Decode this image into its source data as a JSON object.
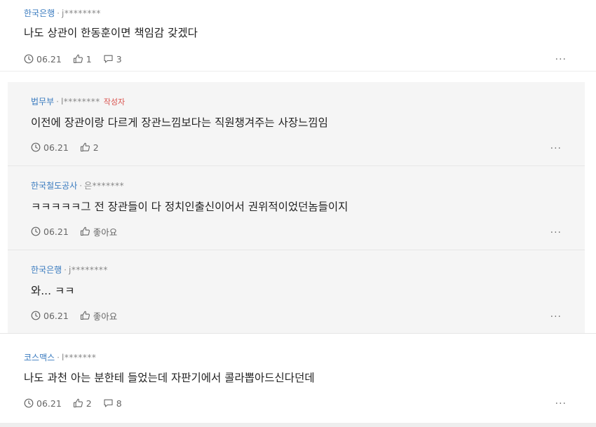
{
  "comments": [
    {
      "org": "한국은행",
      "user": "j********",
      "text": "나도 상관이 한동훈이면 책임감 갖겠다",
      "date": "06.21",
      "likes": "1",
      "replies": "3",
      "more": "···"
    }
  ],
  "replies": [
    {
      "org": "법무부",
      "user": "l********",
      "badge": "작성자",
      "text": "이전에 장관이랑 다르게 장관느낌보다는 직원챙겨주는 사장느낌임",
      "date": "06.21",
      "likes": "2",
      "more": "···"
    },
    {
      "org": "한국철도공사",
      "user": "은*******",
      "text": "ㅋㅋㅋㅋㅋ그 전 장관들이 다 정치인출신이어서 권위적이었던놈들이지",
      "date": "06.21",
      "likes": "좋아요",
      "more": "···"
    },
    {
      "org": "한국은행",
      "user": "j********",
      "text": "와... ㅋㅋ",
      "date": "06.21",
      "likes": "좋아요",
      "more": "···"
    }
  ],
  "last_comment": {
    "org": "코스맥스",
    "user": "l*******",
    "text": "나도 과천 아는 분한테 들었는데 자판기에서 콜라뽑아드신다던데",
    "date": "06.21",
    "likes": "2",
    "replies": "8",
    "more": "···"
  },
  "separator": "·",
  "colors": {
    "org_link": "#3a7bbf",
    "op_badge": "#d9534f",
    "reply_bg": "#f5f5f5"
  },
  "icons": {
    "date": "clock-icon",
    "like": "thumbs-up-icon",
    "reply": "speech-bubble-icon",
    "more": "more-dots-icon"
  }
}
